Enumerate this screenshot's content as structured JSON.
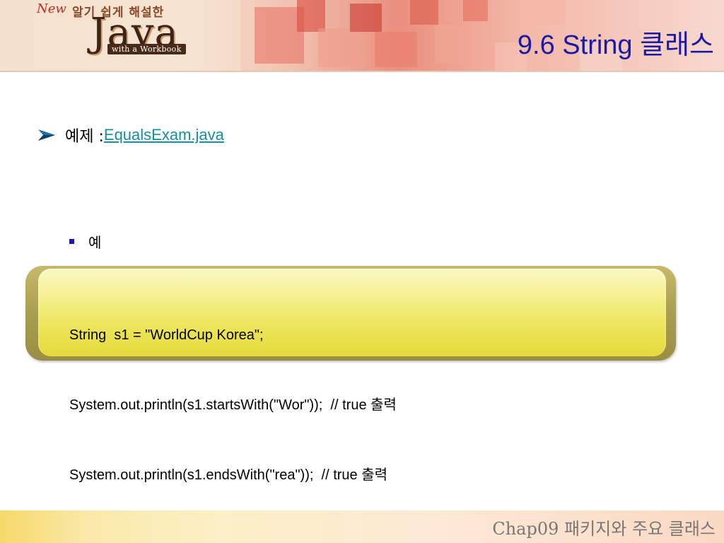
{
  "header": {
    "logo_new": "New",
    "logo_subtitle": "알기 쉽게 해설한",
    "logo_main": "Java",
    "logo_tagline": "with a Workbook",
    "slide_title": "9.6 String 클래스"
  },
  "body": {
    "bullet_label": "예제 : ",
    "bullet_link": "EqualsExam.java",
    "sub_bullet": "예",
    "code_lines": [
      "String  s1 = \"WorldCup Korea\";",
      "System.out.println(s1.startsWith(\"Wor\"));  // true 출력",
      "System.out.println(s1.endsWith(\"rea\"));  // true 출력"
    ]
  },
  "footer": {
    "chapter_text": "Chap09 패키지와 주요 클래스"
  },
  "colors": {
    "title": "#1a1aa8",
    "link": "#1590a0",
    "code_box_outer": "#a99d4f",
    "code_box_inner": "#f5ef8a"
  },
  "icons": {
    "bullet": "arrow-icon",
    "sub_bullet": "square-icon"
  }
}
